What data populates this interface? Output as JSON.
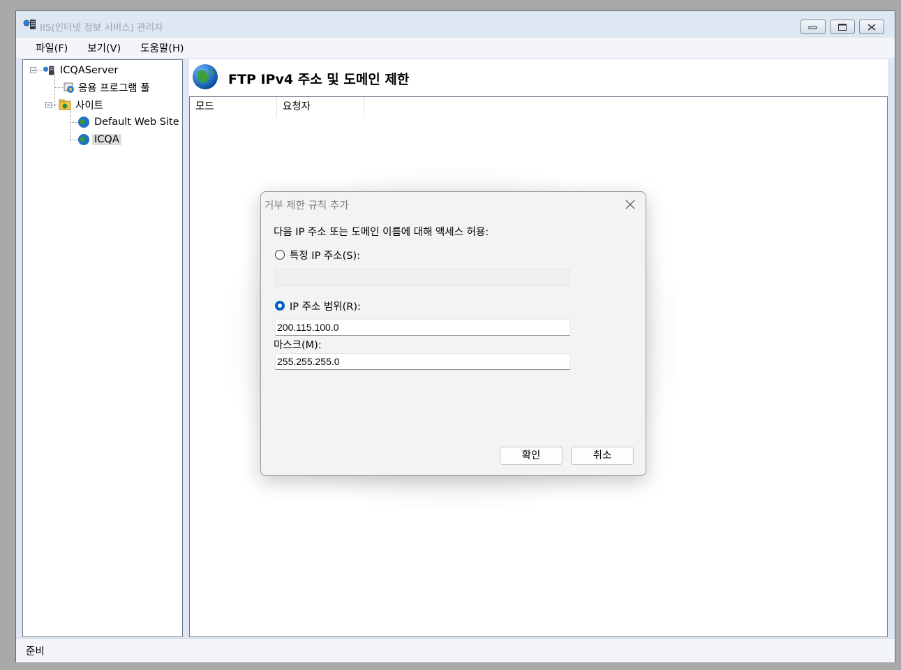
{
  "window": {
    "title": "IIS(인터넷 정보 서비스) 관리자",
    "controls": [
      "minimize",
      "maximize",
      "close"
    ]
  },
  "menu": {
    "items": [
      "파일(F)",
      "보기(V)",
      "도움말(H)"
    ]
  },
  "tree": {
    "server": "ICQAServer",
    "app_pools": "응용 프로그램 풀",
    "sites": "사이트",
    "default_site": "Default Web Site",
    "icqa": "ICQA"
  },
  "main": {
    "title": "FTP IPv4 주소 및 도메인 제한",
    "columns": [
      "모드",
      "요청자"
    ]
  },
  "status": {
    "text": "준비"
  },
  "dialog": {
    "title": "거부 제한 규칙 추가",
    "instruction": "다음 IP 주소 또는 도메인 이름에 대해 액세스 허용:",
    "specific_ip_label": "특정 IP 주소(S):",
    "specific_ip_value": "",
    "range_label": "IP 주소 범위(R):",
    "range_value": "200.115.100.0",
    "mask_label": "마스크(M):",
    "mask_value": "255.255.255.0",
    "selected_option": "IP 주소 범위(R):",
    "ok_label": "확인",
    "cancel_label": "취소"
  },
  "colors": {
    "accent": "#0060c0",
    "window_frame": "#dfe7f3",
    "desktop": "#a9a9a9"
  }
}
